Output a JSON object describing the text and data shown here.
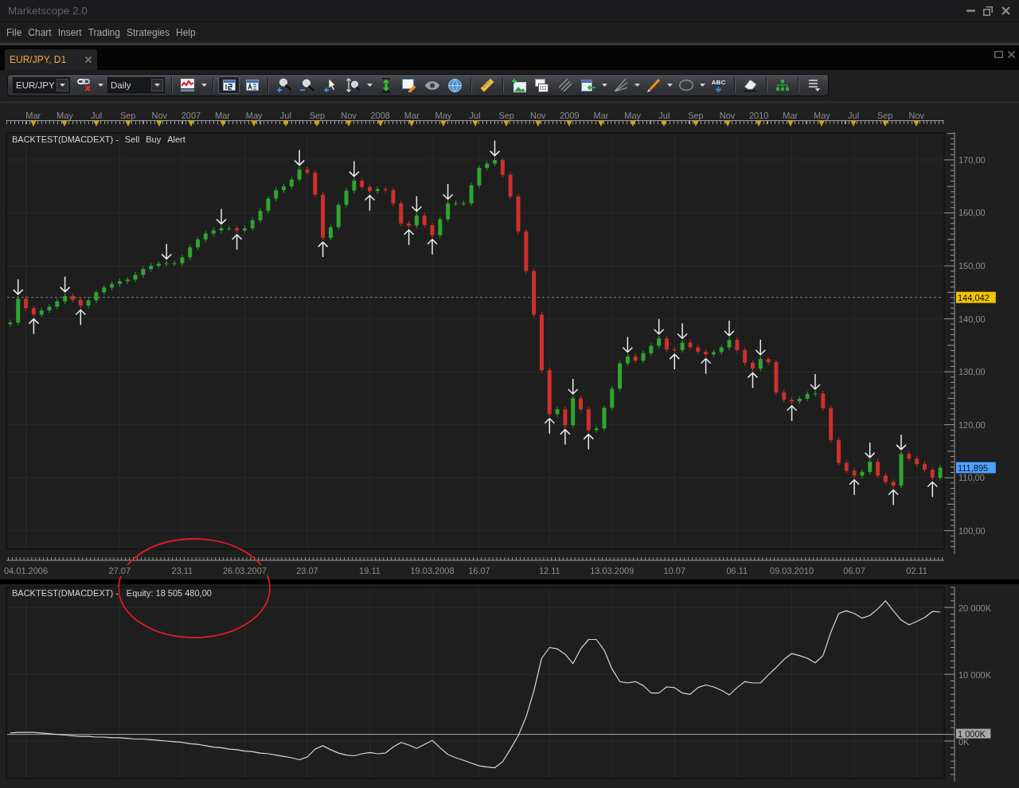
{
  "window": {
    "title": "Marketscope 2.0"
  },
  "menu": [
    "File",
    "Chart",
    "Insert",
    "Trading",
    "Strategies",
    "Help"
  ],
  "tabs": [
    {
      "label": "EUR/JPY, D1",
      "selected": true
    }
  ],
  "toolbar": {
    "groups": [
      [
        {
          "kind": "select",
          "value": "EUR/JPY"
        },
        {
          "kind": "tool",
          "selected": false,
          "menu": true
        },
        {
          "kind": "select",
          "value": "Daily"
        }
      ],
      [
        {
          "kind": "tool",
          "selected": false,
          "menu": true
        }
      ],
      [
        {
          "kind": "tool",
          "selected": true,
          "menu": false
        },
        {
          "kind": "tool",
          "selected": false,
          "menu": false
        }
      ],
      [
        {
          "kind": "tool",
          "selected": false,
          "menu": false
        },
        {
          "kind": "tool",
          "selected": false,
          "menu": false
        },
        {
          "kind": "tool",
          "selected": false,
          "menu": false
        },
        {
          "kind": "tool",
          "selected": false,
          "menu": true
        },
        {
          "kind": "tool",
          "selected": false,
          "menu": false
        },
        {
          "kind": "tool",
          "selected": false,
          "menu": false
        },
        {
          "kind": "tool",
          "selected": false,
          "menu": false
        },
        {
          "kind": "tool",
          "selected": false,
          "menu": false
        }
      ],
      [
        {
          "kind": "tool",
          "selected": false,
          "menu": false
        }
      ],
      [
        {
          "kind": "tool",
          "selected": false,
          "menu": false
        },
        {
          "kind": "tool",
          "selected": false,
          "menu": false
        },
        {
          "kind": "tool",
          "selected": false,
          "menu": false
        },
        {
          "kind": "tool",
          "selected": false,
          "menu": true
        },
        {
          "kind": "tool",
          "selected": false,
          "menu": true
        },
        {
          "kind": "tool",
          "selected": false,
          "menu": true
        },
        {
          "kind": "tool",
          "selected": false,
          "menu": true
        },
        {
          "kind": "tool",
          "selected": false,
          "menu": false,
          "glyph": "ABC"
        }
      ],
      [
        {
          "kind": "tool",
          "selected": false,
          "menu": false
        }
      ],
      [
        {
          "kind": "tool",
          "selected": false,
          "menu": false
        }
      ],
      [
        {
          "kind": "tool",
          "selected": false,
          "menu": false
        }
      ]
    ]
  },
  "price_panel": {
    "time_scale": [
      "Mar",
      "May",
      "Jul",
      "Sep",
      "Nov",
      "2007",
      "Mar",
      "May",
      "Jul",
      "Sep",
      "Nov",
      "2008",
      "Mar",
      "May",
      "Jul",
      "Sep",
      "Nov",
      "2009",
      "Mar",
      "May",
      "Jul",
      "Sep",
      "Nov",
      "2010",
      "Mar",
      "May",
      "Jul",
      "Sep",
      "Nov"
    ],
    "indicator": "BACKTEST(DMACDEXT) -",
    "legend": [
      "Sell",
      "Buy",
      "Alert"
    ],
    "last_price": "111,895",
    "chart_data": {
      "type": "candlestick",
      "grid": true,
      "categories": [
        null,
        null,
        "04.01.2006",
        null,
        null,
        null,
        null,
        null,
        null,
        null,
        null,
        null,
        null,
        null,
        "27.07",
        null,
        null,
        null,
        null,
        null,
        null,
        null,
        "23.11",
        null,
        null,
        null,
        null,
        null,
        null,
        null,
        "26.03.2007",
        null,
        null,
        null,
        null,
        null,
        null,
        null,
        "23.07",
        null,
        null,
        null,
        null,
        null,
        null,
        null,
        "19.11",
        null,
        null,
        null,
        null,
        null,
        null,
        null,
        "19.03.2008",
        null,
        null,
        null,
        null,
        null,
        "16.07",
        null,
        null,
        null,
        null,
        null,
        null,
        null,
        null,
        "12.11",
        null,
        null,
        null,
        null,
        null,
        null,
        null,
        "13.03.2009",
        null,
        null,
        null,
        null,
        null,
        null,
        null,
        "10.07",
        null,
        null,
        null,
        null,
        null,
        null,
        null,
        "06.11",
        null,
        null,
        null,
        null,
        null,
        null,
        "09.03.2010",
        null,
        null,
        null,
        null,
        null,
        null,
        null,
        "06.07",
        null,
        null,
        null,
        null,
        null,
        null,
        null,
        "02.11",
        null,
        null,
        null
      ],
      "ohlc": [
        [
          139.0,
          139.8,
          138.5,
          139.3
        ],
        [
          139.3,
          144.3,
          138.8,
          143.8
        ],
        [
          143.8,
          144.3,
          141.5,
          142.0
        ],
        [
          142.0,
          142.5,
          140.3,
          140.8
        ],
        [
          140.8,
          142.1,
          140.3,
          141.6
        ],
        [
          141.6,
          142.8,
          141.1,
          142.3
        ],
        [
          142.3,
          143.8,
          141.8,
          143.3
        ],
        [
          143.3,
          144.8,
          142.8,
          144.3
        ],
        [
          144.3,
          144.8,
          143.1,
          143.6
        ],
        [
          143.6,
          144.1,
          142.0,
          142.5
        ],
        [
          142.5,
          144.0,
          142.0,
          143.5
        ],
        [
          143.5,
          145.5,
          143.0,
          145.0
        ],
        [
          145.0,
          146.4,
          144.5,
          145.9
        ],
        [
          145.9,
          147.1,
          145.4,
          146.6
        ],
        [
          146.6,
          147.6,
          146.1,
          147.1
        ],
        [
          147.1,
          147.9,
          146.6,
          147.4
        ],
        [
          147.4,
          148.8,
          146.9,
          148.3
        ],
        [
          148.3,
          149.9,
          147.8,
          149.4
        ],
        [
          149.4,
          150.5,
          148.9,
          150.0
        ],
        [
          150.0,
          150.9,
          149.5,
          150.4
        ],
        [
          150.4,
          151.0,
          149.9,
          150.5
        ],
        [
          150.5,
          151.0,
          150.0,
          150.5
        ],
        [
          150.5,
          152.1,
          150.0,
          151.6
        ],
        [
          151.6,
          154.0,
          151.1,
          153.5
        ],
        [
          153.5,
          155.5,
          153.0,
          155.0
        ],
        [
          155.0,
          156.6,
          154.5,
          156.1
        ],
        [
          156.1,
          157.2,
          155.6,
          156.7
        ],
        [
          156.7,
          157.6,
          156.2,
          157.1
        ],
        [
          157.1,
          157.6,
          156.6,
          157.1
        ],
        [
          157.1,
          157.6,
          156.2,
          156.7
        ],
        [
          156.7,
          157.6,
          156.2,
          157.1
        ],
        [
          157.1,
          159.1,
          156.6,
          158.6
        ],
        [
          158.6,
          160.9,
          158.1,
          160.4
        ],
        [
          160.4,
          163.2,
          159.9,
          162.7
        ],
        [
          162.7,
          164.8,
          162.2,
          164.3
        ],
        [
          164.3,
          165.5,
          163.8,
          165.0
        ],
        [
          165.0,
          166.8,
          164.5,
          166.3
        ],
        [
          166.3,
          168.7,
          165.8,
          168.2
        ],
        [
          168.2,
          168.7,
          167.1,
          167.6
        ],
        [
          167.6,
          168.1,
          162.9,
          163.4
        ],
        [
          163.4,
          163.9,
          154.8,
          155.3
        ],
        [
          155.3,
          157.8,
          154.8,
          157.3
        ],
        [
          157.3,
          162.0,
          156.8,
          161.5
        ],
        [
          161.5,
          164.7,
          161.0,
          164.2
        ],
        [
          164.2,
          166.6,
          163.7,
          166.1
        ],
        [
          166.1,
          166.6,
          164.4,
          164.9
        ],
        [
          164.9,
          165.4,
          163.6,
          164.1
        ],
        [
          164.1,
          165.0,
          163.6,
          164.5
        ],
        [
          164.5,
          165.0,
          163.8,
          164.3
        ],
        [
          164.3,
          164.8,
          161.3,
          161.8
        ],
        [
          161.8,
          162.3,
          157.5,
          158.0
        ],
        [
          158.0,
          158.5,
          157.1,
          157.6
        ],
        [
          157.6,
          160.0,
          157.1,
          159.5
        ],
        [
          159.5,
          160.0,
          157.2,
          157.7
        ],
        [
          157.7,
          158.2,
          155.3,
          155.8
        ],
        [
          155.8,
          159.3,
          155.3,
          158.8
        ],
        [
          158.8,
          162.3,
          158.3,
          161.8
        ],
        [
          161.8,
          162.3,
          161.3,
          161.8
        ],
        [
          161.8,
          162.3,
          161.3,
          161.8
        ],
        [
          161.8,
          165.7,
          161.3,
          165.2
        ],
        [
          165.2,
          169.0,
          164.7,
          168.5
        ],
        [
          168.5,
          169.8,
          168.0,
          169.3
        ],
        [
          169.3,
          170.5,
          168.8,
          170.0
        ],
        [
          170.0,
          170.5,
          166.7,
          167.2
        ],
        [
          167.2,
          167.7,
          162.6,
          163.1
        ],
        [
          163.1,
          163.6,
          156.0,
          156.5
        ],
        [
          156.5,
          157.0,
          148.5,
          149.0
        ],
        [
          149.0,
          149.5,
          140.3,
          140.8
        ],
        [
          140.8,
          141.3,
          129.8,
          130.3
        ],
        [
          130.3,
          130.8,
          121.5,
          122.0
        ],
        [
          122.0,
          123.4,
          121.5,
          122.9
        ],
        [
          122.9,
          123.4,
          119.4,
          119.9
        ],
        [
          119.9,
          125.5,
          119.4,
          125.0
        ],
        [
          125.0,
          125.5,
          122.4,
          122.9
        ],
        [
          122.9,
          123.4,
          118.5,
          119.0
        ],
        [
          119.0,
          119.8,
          118.5,
          119.3
        ],
        [
          119.3,
          123.7,
          118.8,
          123.2
        ],
        [
          123.2,
          127.3,
          122.7,
          126.8
        ],
        [
          126.8,
          132.1,
          126.3,
          131.6
        ],
        [
          131.6,
          133.4,
          131.1,
          132.9
        ],
        [
          132.9,
          133.4,
          131.6,
          132.1
        ],
        [
          132.1,
          134.0,
          131.6,
          133.5
        ],
        [
          133.5,
          135.4,
          133.0,
          134.9
        ],
        [
          134.9,
          136.8,
          134.4,
          136.3
        ],
        [
          136.3,
          136.8,
          133.7,
          134.2
        ],
        [
          134.2,
          134.7,
          133.6,
          134.1
        ],
        [
          134.1,
          136.0,
          133.6,
          135.5
        ],
        [
          135.5,
          136.0,
          134.1,
          134.6
        ],
        [
          134.6,
          135.1,
          133.3,
          133.8
        ],
        [
          133.8,
          134.3,
          132.8,
          133.3
        ],
        [
          133.3,
          134.2,
          132.8,
          133.7
        ],
        [
          133.7,
          135.1,
          133.2,
          134.6
        ],
        [
          134.6,
          136.5,
          134.1,
          136.0
        ],
        [
          136.0,
          136.5,
          133.6,
          134.1
        ],
        [
          134.1,
          134.6,
          131.2,
          131.7
        ],
        [
          131.7,
          132.2,
          130.1,
          130.6
        ],
        [
          130.6,
          132.9,
          130.1,
          132.4
        ],
        [
          132.4,
          132.9,
          131.3,
          131.8
        ],
        [
          131.8,
          132.3,
          125.6,
          126.1
        ],
        [
          126.1,
          126.6,
          124.2,
          124.7
        ],
        [
          124.7,
          125.2,
          123.9,
          124.4
        ],
        [
          124.4,
          125.4,
          123.9,
          124.9
        ],
        [
          124.9,
          126.3,
          124.4,
          125.8
        ],
        [
          125.8,
          126.4,
          125.3,
          125.9
        ],
        [
          125.9,
          126.4,
          122.6,
          123.1
        ],
        [
          123.1,
          123.6,
          116.6,
          117.1
        ],
        [
          117.1,
          117.6,
          112.3,
          112.8
        ],
        [
          112.8,
          113.3,
          110.8,
          111.3
        ],
        [
          111.3,
          111.8,
          109.9,
          110.4
        ],
        [
          110.4,
          111.6,
          109.9,
          111.1
        ],
        [
          111.1,
          113.5,
          110.6,
          113.0
        ],
        [
          113.0,
          113.5,
          109.9,
          110.4
        ],
        [
          110.4,
          110.9,
          108.7,
          109.2
        ],
        [
          109.2,
          109.7,
          108.0,
          108.5
        ],
        [
          108.5,
          115.0,
          108.0,
          114.5
        ],
        [
          114.5,
          115.0,
          113.1,
          113.6
        ],
        [
          113.6,
          114.1,
          112.1,
          112.6
        ],
        [
          112.6,
          113.1,
          111.0,
          111.5
        ],
        [
          111.5,
          112.0,
          109.5,
          110.0
        ],
        [
          110.0,
          112.4,
          109.5,
          111.9
        ]
      ],
      "ylim": [
        96.5,
        175.1
      ],
      "yticks": [
        {
          "value": 100,
          "label": "100,00"
        },
        {
          "value": 110,
          "label": "110,00"
        },
        {
          "value": 120,
          "label": "120,00"
        },
        {
          "value": 130,
          "label": "130,00"
        },
        {
          "value": 140,
          "label": "140,00"
        },
        {
          "value": 150,
          "label": "150,00"
        },
        {
          "value": 160,
          "label": "160,00"
        },
        {
          "value": 170,
          "label": "170,00"
        }
      ],
      "ref_lines": [
        {
          "axis": "y",
          "value": 144.042,
          "label": "144,042",
          "color": "#808080"
        }
      ]
    }
  },
  "equity_panel": {
    "indicator": "BACKTEST(DMACDEXT) -",
    "equity": "Equity: 18 505 480,00",
    "chart_data": {
      "type": "line",
      "grid": true,
      "categories": [
        null,
        null,
        null,
        null,
        null,
        null,
        null,
        null,
        null,
        null,
        null,
        null,
        null,
        null,
        null,
        null,
        null,
        null,
        null,
        null,
        null,
        null,
        null,
        null,
        null,
        null,
        null,
        null,
        null,
        null,
        null,
        null,
        null,
        null,
        null,
        null,
        null,
        null,
        null,
        null,
        null,
        null,
        null,
        null,
        null,
        null,
        null,
        null,
        null,
        null,
        null,
        null,
        null,
        null,
        null,
        null,
        null,
        null,
        null,
        null,
        null,
        null,
        null,
        null,
        null,
        null,
        null,
        null,
        null,
        null,
        null,
        null,
        null,
        null,
        null,
        null,
        null,
        null,
        null,
        null,
        null,
        null,
        null,
        null,
        null,
        null,
        null,
        null,
        null,
        null,
        null,
        null,
        null,
        null,
        null,
        null,
        null,
        null,
        null,
        null,
        null,
        null,
        null,
        null,
        null,
        null,
        null,
        null,
        null,
        null,
        null,
        null,
        null,
        null,
        null,
        null,
        null,
        null,
        null,
        null
      ],
      "series": [
        {
          "color": "#d8d8d8",
          "values": [
            1200,
            1300,
            1300,
            1300,
            1200,
            1100,
            1000,
            900,
            800,
            700,
            700,
            600,
            600,
            500,
            500,
            400,
            300,
            300,
            200,
            100,
            0,
            -100,
            -200,
            -400,
            -500,
            -700,
            -900,
            -1000,
            -1200,
            -1300,
            -1500,
            -1600,
            -1800,
            -1900,
            -2100,
            -2300,
            -2500,
            -2800,
            -2400,
            -1200,
            -700,
            -1300,
            -1800,
            -2100,
            -2200,
            -1900,
            -1700,
            -1900,
            -1800,
            -900,
            -200,
            -600,
            -1100,
            -500,
            100,
            -1000,
            -2000,
            -2500,
            -2900,
            -3300,
            -3700,
            -3900,
            -4000,
            -3100,
            -1200,
            800,
            3600,
            7500,
            12400,
            14000,
            13800,
            13000,
            11600,
            13800,
            15200,
            15200,
            13600,
            10800,
            8900,
            8700,
            8900,
            8300,
            7200,
            7200,
            8100,
            8000,
            7200,
            7000,
            8000,
            8400,
            8100,
            7600,
            6900,
            8000,
            8900,
            8700,
            8700,
            9900,
            11000,
            12200,
            13100,
            12800,
            12400,
            11700,
            12800,
            16300,
            19100,
            19500,
            19100,
            18400,
            18800,
            19800,
            21000,
            19500,
            18100,
            17400,
            17900,
            18500,
            19400,
            19300
          ]
        }
      ],
      "ylim": [
        -5600,
        23000
      ],
      "yticks": [
        {
          "value": 20000,
          "label": "20 000K"
        },
        {
          "value": 10000,
          "label": "10 000K"
        },
        {
          "value": 0,
          "label": "0K"
        }
      ],
      "ref_lines": [
        {
          "axis": "y",
          "value": 1000,
          "label": "1 000K",
          "color": "#a8a8a8"
        }
      ]
    }
  }
}
